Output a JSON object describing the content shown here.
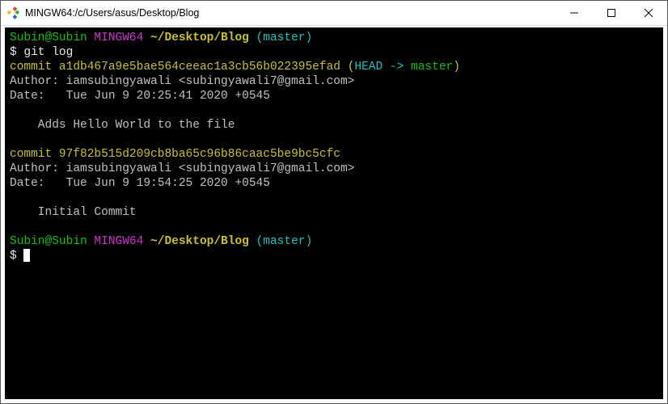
{
  "titlebar": {
    "title": "MINGW64:/c/Users/asus/Desktop/Blog"
  },
  "prompt1": {
    "user": "Subin@Subin",
    "env": "MINGW64",
    "path": "~/Desktop/Blog",
    "branch_open": "(",
    "branch": "master",
    "branch_close": ")"
  },
  "cmd1": {
    "dollar": "$",
    "command": "git log"
  },
  "commit1": {
    "label": "commit",
    "hash": "a1db467a9e5bae564ceeac1a3cb56b022395efad",
    "paren_open": "(",
    "head": "HEAD -> ",
    "master": "master",
    "paren_close": ")",
    "author": "Author: iamsubingyawali <subingyawali7@gmail.com>",
    "date": "Date:   Tue Jun 9 20:25:41 2020 +0545",
    "message": "    Adds Hello World to the file"
  },
  "commit2": {
    "label": "commit",
    "hash": "97f82b515d209cb8ba65c96b86caac5be9bc5cfc",
    "author": "Author: iamsubingyawali <subingyawali7@gmail.com>",
    "date": "Date:   Tue Jun 9 19:54:25 2020 +0545",
    "message": "    Initial Commit"
  },
  "prompt2": {
    "user": "Subin@Subin",
    "env": "MINGW64",
    "path": "~/Desktop/Blog",
    "branch_open": "(",
    "branch": "master",
    "branch_close": ")"
  },
  "cmd2": {
    "dollar": "$"
  }
}
